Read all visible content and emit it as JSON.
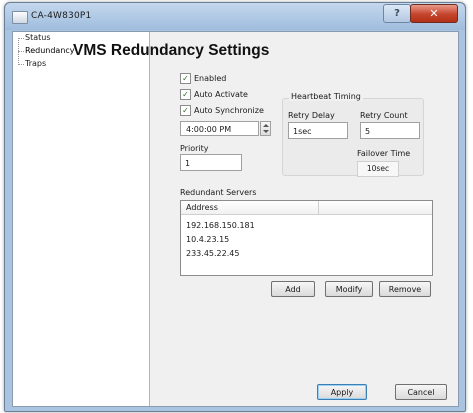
{
  "window": {
    "title": "CA-4W830P1",
    "help_label": "?",
    "close_label": "✕"
  },
  "tree": {
    "items": [
      {
        "label": "Status"
      },
      {
        "label": "Redundancy",
        "selected": true
      },
      {
        "label": "Traps"
      }
    ]
  },
  "main": {
    "heading": "VMS Redundancy Settings",
    "checkboxes": {
      "enabled": {
        "label": "Enabled",
        "checked": true
      },
      "auto_activate": {
        "label": "Auto Activate",
        "checked": true
      },
      "auto_synchronize": {
        "label": "Auto Synchronize",
        "checked": true
      }
    },
    "sync_time": "4:00:00 PM",
    "priority": {
      "label": "Priority",
      "value": "1"
    },
    "heartbeat": {
      "legend": "Heartbeat Timing",
      "retry_delay": {
        "label": "Retry Delay",
        "value": "1sec"
      },
      "retry_count": {
        "label": "Retry Count",
        "value": "5"
      },
      "failover_time": {
        "label": "Failover Time",
        "value": "10sec"
      }
    },
    "redundant_servers": {
      "label": "Redundant Servers",
      "column_header": "Address",
      "rows": [
        "192.168.150.181",
        "10.4.23.15",
        "233.45.22.45"
      ]
    },
    "buttons": {
      "add": "Add",
      "modify": "Modify",
      "remove": "Remove",
      "apply": "Apply",
      "cancel": "Cancel"
    },
    "check_mark": "✓"
  }
}
